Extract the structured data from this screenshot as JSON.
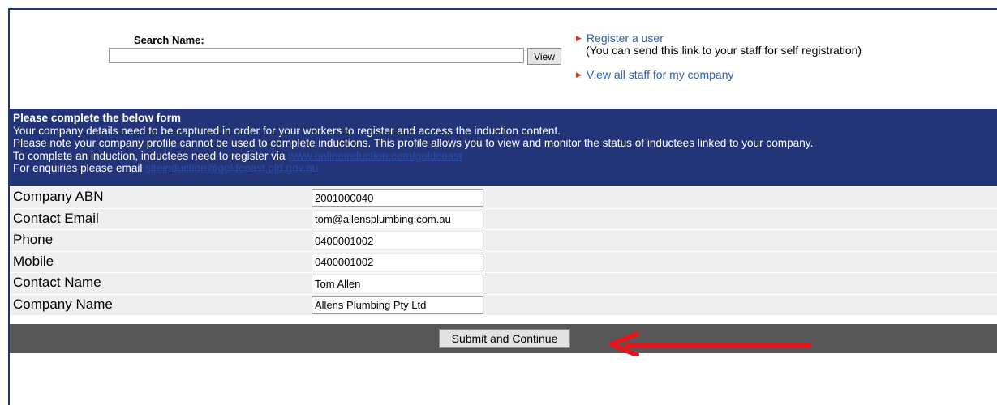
{
  "search": {
    "label": "Search Name:",
    "value": "",
    "view_label": "View"
  },
  "links": {
    "register": "Register a user",
    "register_note": "(You can send this link to your staff for self registration)",
    "view_staff": "View all staff for my company"
  },
  "info": {
    "heading": "Please complete the below form",
    "line1": "Your company details need to be captured in order for your workers to register and access the induction content.",
    "line2": "Please note your company profile cannot be used to complete inductions. This profile allows you to view and monitor the status of inductees linked to your company.",
    "line3_text": "To complete an induction, inductees need to register via",
    "line3_link": "www.onlineinduction.com/goldcoast",
    "line4_text": "For enquiries please email",
    "line4_link": "siteinduction@goldcoast.qld.gov.au"
  },
  "form": {
    "fields": [
      {
        "label": "Company ABN",
        "value": "2001000040"
      },
      {
        "label": "Contact Email",
        "value": "tom@allensplumbing.com.au"
      },
      {
        "label": "Phone",
        "value": "0400001002"
      },
      {
        "label": "Mobile",
        "value": "0400001002"
      },
      {
        "label": "Contact Name",
        "value": "Tom Allen"
      },
      {
        "label": "Company Name",
        "value": "Allens Plumbing Pty Ltd"
      }
    ],
    "submit_label": "Submit and Continue"
  },
  "colors": {
    "panel_blue": "#233578",
    "submit_bar": "#575757",
    "arrow_red": "#e8141b"
  },
  "icons": {
    "link_bullet": "triangle-right-icon",
    "annotation": "red-arrow-left-icon"
  }
}
